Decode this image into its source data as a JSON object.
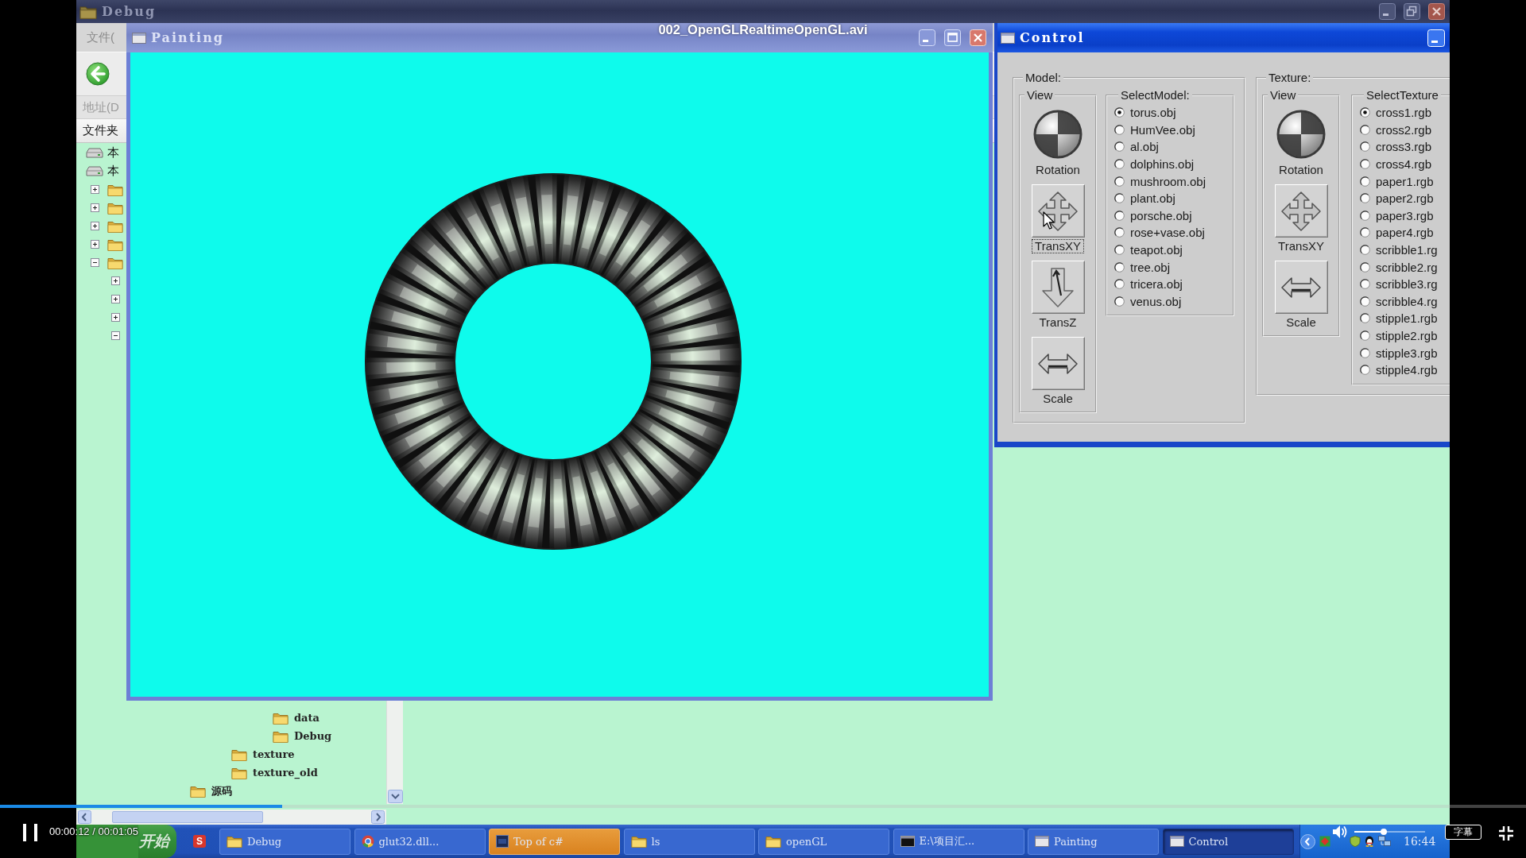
{
  "player": {
    "title": "002_OpenGLRealtimeOpenGL.avi",
    "playing": true,
    "time": "00:00:12 / 00:01:05",
    "progress": {
      "level": 0.185
    },
    "volume": {
      "level": 0.42
    },
    "subtitles_button": "字幕"
  },
  "explorer": {
    "title": "Debug",
    "active": false,
    "menu": [
      "文件("
    ],
    "address_label": "地址(D",
    "folder_pane": {
      "header": "文件夹",
      "tree": [
        {
          "kind": "drive",
          "label": "本"
        },
        {
          "kind": "drive",
          "label": "本",
          "children": [
            {
              "kind": "folder",
              "expanded": false
            },
            {
              "kind": "folder",
              "expanded": false
            },
            {
              "kind": "folder",
              "expanded": false
            },
            {
              "kind": "folder",
              "expanded": false
            },
            {
              "kind": "folder",
              "expanded": true,
              "children": [
                {
                  "expanded": false
                },
                {
                  "expanded": false
                },
                {
                  "expanded": false
                },
                {
                  "expanded": true
                }
              ]
            }
          ]
        }
      ],
      "tree_lower": [
        {
          "children": [
            {
              "children": [
                {
                  "children": [
                    {
                      "children": [
                        {
                          "kind": "folder",
                          "label": "data"
                        },
                        {
                          "kind": "folder",
                          "label": "Debug"
                        }
                      ]
                    }
                  ]
                },
                {
                  "kind": "folder",
                  "label": "texture"
                },
                {
                  "kind": "folder",
                  "label": "texture_old"
                }
              ]
            }
          ]
        },
        {
          "kind": "folder",
          "label": "源码"
        }
      ]
    }
  },
  "painting_window": {
    "title": "Painting",
    "active": false
  },
  "control_window": {
    "title": "Control",
    "active": true,
    "groups": [
      {
        "label": "Model:",
        "view": {
          "label": "View",
          "controls": [
            {
              "kind": "rotation",
              "label": "Rotation",
              "focused": false
            },
            {
              "kind": "trans_xy",
              "label": "TransXY",
              "focused": true
            },
            {
              "kind": "trans_z",
              "label": "TransZ",
              "focused": false
            },
            {
              "kind": "scale",
              "label": "Scale",
              "focused": false
            }
          ]
        },
        "select": {
          "label": "SelectModel:",
          "options": [
            {
              "label": "torus.obj",
              "selected": true
            },
            {
              "label": "HumVee.obj",
              "selected": false
            },
            {
              "label": "al.obj",
              "selected": false
            },
            {
              "label": "dolphins.obj",
              "selected": false
            },
            {
              "label": "mushroom.obj",
              "selected": false
            },
            {
              "label": "plant.obj",
              "selected": false
            },
            {
              "label": "porsche.obj",
              "selected": false
            },
            {
              "label": "rose+vase.obj",
              "selected": false
            },
            {
              "label": "teapot.obj",
              "selected": false
            },
            {
              "label": "tree.obj",
              "selected": false
            },
            {
              "label": "tricera.obj",
              "selected": false
            },
            {
              "label": "venus.obj",
              "selected": false
            }
          ]
        }
      },
      {
        "label": "Texture:",
        "view": {
          "label": "View",
          "controls": [
            {
              "kind": "rotation",
              "label": "Rotation",
              "focused": false
            },
            {
              "kind": "trans_xy",
              "label": "TransXY",
              "focused": false
            },
            {
              "kind": "scale",
              "label": "Scale",
              "focused": false
            }
          ]
        },
        "select": {
          "label": "SelectTexture",
          "options": [
            {
              "label": "cross1.rgb",
              "selected": true
            },
            {
              "label": "cross2.rgb",
              "selected": false
            },
            {
              "label": "cross3.rgb",
              "selected": false
            },
            {
              "label": "cross4.rgb",
              "selected": false
            },
            {
              "label": "paper1.rgb",
              "selected": false
            },
            {
              "label": "paper2.rgb",
              "selected": false
            },
            {
              "label": "paper3.rgb",
              "selected": false
            },
            {
              "label": "paper4.rgb",
              "selected": false
            },
            {
              "label": "scribble1.rg",
              "selected": false
            },
            {
              "label": "scribble2.rg",
              "selected": false
            },
            {
              "label": "scribble3.rg",
              "selected": false
            },
            {
              "label": "scribble4.rg",
              "selected": false
            },
            {
              "label": "stipple1.rgb",
              "selected": false
            },
            {
              "label": "stipple2.rgb",
              "selected": false
            },
            {
              "label": "stipple3.rgb",
              "selected": false
            },
            {
              "label": "stipple4.rgb",
              "selected": false
            }
          ]
        }
      }
    ]
  },
  "taskbar": {
    "start_button": "开始",
    "quick_launch": [
      "S"
    ],
    "items": [
      {
        "kind": "folder",
        "label": "Debug",
        "selected": false,
        "flashing": false
      },
      {
        "kind": "browser",
        "label": "glut32.dll...",
        "selected": false,
        "flashing": false
      },
      {
        "kind": "ide",
        "label": "Top of c#",
        "selected": false,
        "flashing": true
      },
      {
        "kind": "folder",
        "label": "ls",
        "selected": false,
        "flashing": false
      },
      {
        "kind": "folder",
        "label": "openGL",
        "selected": false,
        "flashing": false
      },
      {
        "kind": "console",
        "label": "E:\\项目汇...",
        "selected": false,
        "flashing": false
      },
      {
        "kind": "window",
        "label": "Painting",
        "selected": false,
        "flashing": false
      },
      {
        "kind": "window",
        "label": "Control",
        "selected": true,
        "flashing": false
      }
    ],
    "clock": "16:44"
  }
}
